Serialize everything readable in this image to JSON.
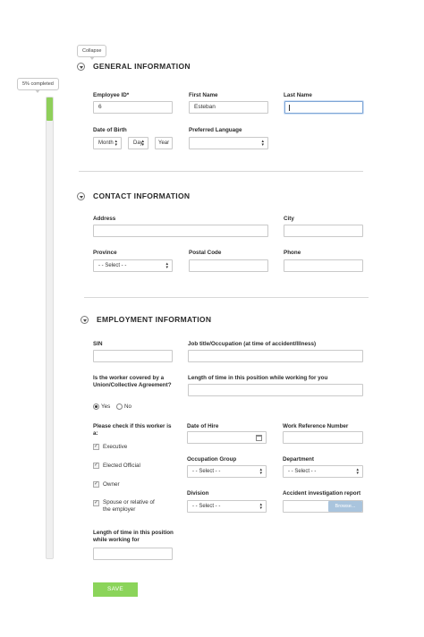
{
  "progress": {
    "collapse_tooltip": "Collapse",
    "completed_label": "5% completed",
    "percent": 5
  },
  "general": {
    "title": "GENERAL INFORMATION",
    "employee_id_label": "Employee ID*",
    "employee_id_value": "6",
    "first_name_label": "First Name",
    "first_name_value": "Esteban",
    "last_name_label": "Last Name",
    "last_name_value": "",
    "dob_label": "Date of Birth",
    "dob_month": "Month",
    "dob_day": "Day",
    "dob_year": "Year",
    "language_label": "Preferred Language",
    "language_value": ""
  },
  "contact": {
    "title": "CONTACT INFORMATION",
    "address_label": "Address",
    "city_label": "City",
    "province_label": "Province",
    "province_value": "- - Select - -",
    "postal_label": "Postal Code",
    "phone_label": "Phone"
  },
  "employment": {
    "title": "EMPLOYMENT INFORMATION",
    "sin_label": "SIN",
    "job_label": "Job title/Occupation (at time of accident/Illness)",
    "union_label": "Is the worker covered by a Union/Collective Agreement?",
    "union_yes": "Yes",
    "union_no": "No",
    "length_label": "Length of time in this position while working for you",
    "check_label": "Please check if this worker is a:",
    "checks": [
      "Executive",
      "Elected Official",
      "Owner",
      "Spouse or relative of the employer"
    ],
    "hire_label": "Date of Hire",
    "ref_label": "Work Reference Number",
    "occ_group_label": "Occupation Group",
    "occ_group_value": "- - Select - -",
    "department_label": "Department",
    "department_value": "- - Select - -",
    "division_label": "Division",
    "division_value": "- - Select - -",
    "report_label": "Accident investigation report",
    "browse_label": "Browse...",
    "length2_label": "Length of time in this position while working for"
  },
  "actions": {
    "save_label": "SAVE"
  },
  "colors": {
    "progress": "#8fcf5a",
    "save": "#8bd45a",
    "browse": "#a9c4dd",
    "focus": "#7fa6d6"
  }
}
